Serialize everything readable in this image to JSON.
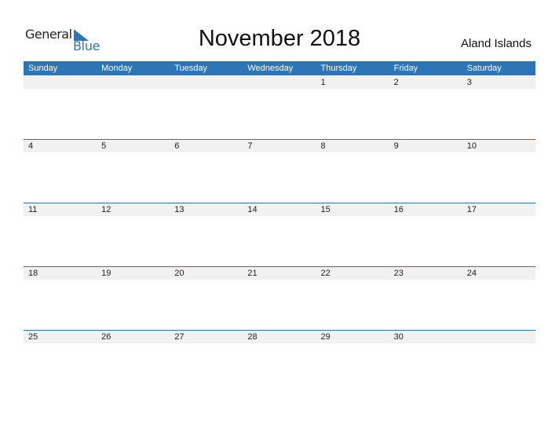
{
  "logo": {
    "general": "General",
    "blue": "Blue"
  },
  "title": "November 2018",
  "country": "Aland Islands",
  "colors": {
    "accent": "#2e75b6",
    "row_bg": "#f1f1f1"
  },
  "weekdays": [
    "Sunday",
    "Monday",
    "Tuesday",
    "Wednesday",
    "Thursday",
    "Friday",
    "Saturday"
  ],
  "weeks": [
    [
      "",
      "",
      "",
      "",
      "1",
      "2",
      "3"
    ],
    [
      "4",
      "5",
      "6",
      "7",
      "8",
      "9",
      "10"
    ],
    [
      "11",
      "12",
      "13",
      "14",
      "15",
      "16",
      "17"
    ],
    [
      "18",
      "19",
      "20",
      "21",
      "22",
      "23",
      "24"
    ],
    [
      "25",
      "26",
      "27",
      "28",
      "29",
      "30",
      ""
    ]
  ]
}
